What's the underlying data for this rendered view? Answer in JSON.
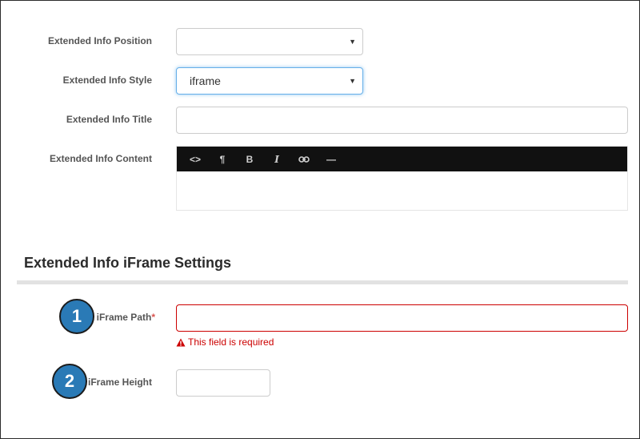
{
  "form": {
    "position": {
      "label": "Extended Info Position",
      "value": ""
    },
    "style": {
      "label": "Extended Info Style",
      "value": "iframe"
    },
    "title": {
      "label": "Extended Info Title",
      "value": ""
    },
    "content": {
      "label": "Extended Info Content",
      "toolbar": [
        {
          "name": "code-view-button",
          "icon": "code-icon",
          "glyph": "<>"
        },
        {
          "name": "paragraph-button",
          "icon": "paragraph-icon",
          "glyph": "¶"
        },
        {
          "name": "bold-button",
          "icon": "bold-icon",
          "glyph": "B"
        },
        {
          "name": "italic-button",
          "icon": "italic-icon",
          "glyph": "I"
        },
        {
          "name": "link-button",
          "icon": "link-icon",
          "glyph": ""
        },
        {
          "name": "horizontal-rule-button",
          "icon": "horizontal-rule-icon",
          "glyph": "—"
        }
      ]
    }
  },
  "iframe_settings": {
    "heading": "Extended Info iFrame Settings",
    "path": {
      "badge": "1",
      "label": "iFrame Path",
      "required_mark": "*",
      "value": "",
      "error": "This field is required"
    },
    "height": {
      "badge": "2",
      "label": "iFrame Height",
      "value": ""
    }
  },
  "colors": {
    "badge": "#2a7ab6",
    "error": "#cc0000",
    "toolbar": "#111111",
    "focus": "#66afe9"
  }
}
